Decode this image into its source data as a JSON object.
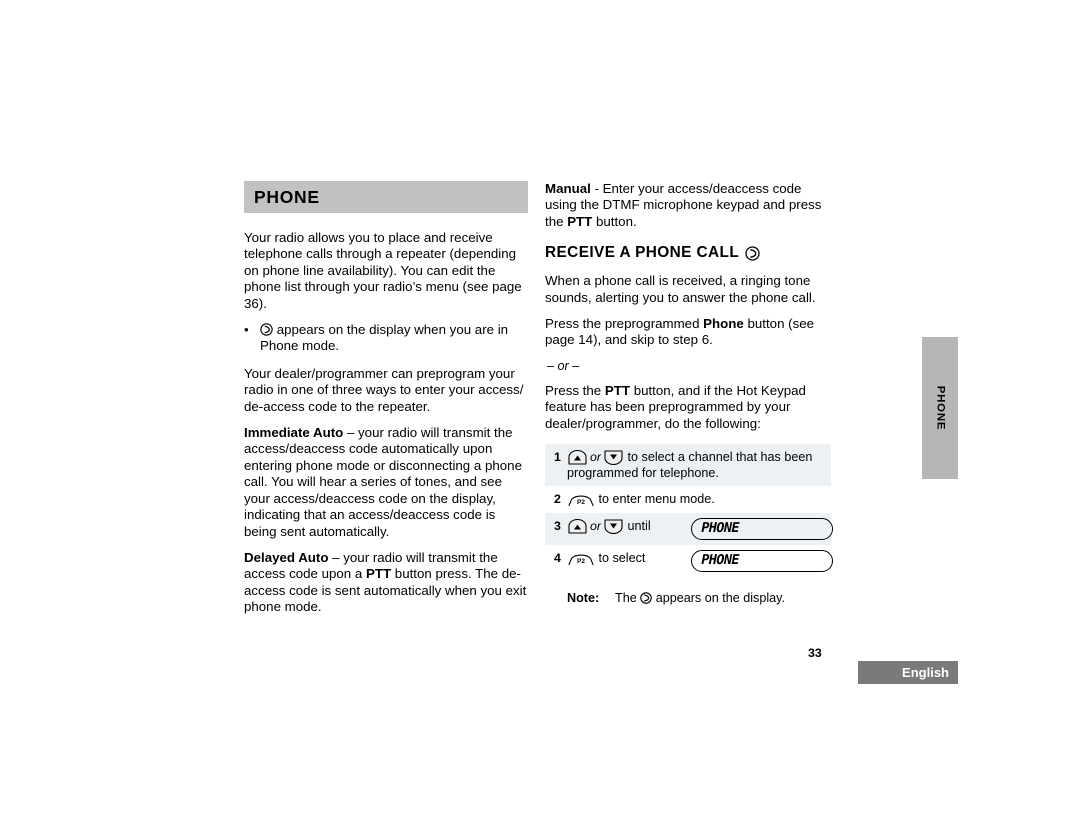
{
  "section": {
    "title": "PHONE"
  },
  "icons": {
    "phone_symbol": "phone-circle-icon",
    "up_key": "up-arrow-key-icon",
    "down_key": "down-arrow-key-icon",
    "p2_key": "p2-button-icon"
  },
  "left_column": {
    "paragraph_1": "Your radio allows you to place and receive telephone calls through a repeater (depending on phone line availability). You can edit the phone list through your radio’s menu (see page 36).",
    "bullet": {
      "marker": "•",
      "text_after_icon": " appears on the display when you are in Phone mode."
    },
    "paragraph_2": "Your dealer/programmer can preprogram your radio in one of three ways to enter your access/ de-access code to the repeater.",
    "immediate_auto": {
      "term": "Immediate Auto",
      "body": " – your radio will transmit the access/deaccess code automatically upon entering phone mode or disconnecting a phone call. You will hear a series of tones, and see your access/deaccess code on the display, indicating that an access/deaccess code is being sent automatically."
    },
    "delayed_auto": {
      "term": "Delayed Auto",
      "body_part1": " – your radio will transmit the access code upon a ",
      "ptt": "PTT",
      "body_part2": " button press. The de-access code is sent automatically when you exit phone mode."
    }
  },
  "right_column": {
    "manual": {
      "term": "Manual",
      "body_part1": " - Enter your access/deaccess code using the DTMF microphone keypad and press the ",
      "ptt": "PTT",
      "body_part2": " button."
    },
    "heading": "RECEIVE A PHONE CALL",
    "paragraph_1": "When a phone call is received, a ringing tone sounds, alerting you to answer the phone call.",
    "paragraph_2_part1": "Press the preprogrammed ",
    "paragraph_2_bold": "Phone",
    "paragraph_2_part2": " button (see page 14), and skip to step 6.",
    "or_line": "– or –",
    "paragraph_3_part1": "Press the ",
    "paragraph_3_bold": "PTT",
    "paragraph_3_part2": " button, and if the Hot Keypad feature has been preprogrammed by your dealer/programmer, do the following:",
    "steps": [
      {
        "num": "1",
        "keys": [
          "up",
          "or",
          "down"
        ],
        "text": " to select a channel that has been programmed for telephone.",
        "lcd": null,
        "shaded": true
      },
      {
        "num": "2",
        "keys": [
          "p2"
        ],
        "text": " to enter menu mode.",
        "lcd": null,
        "shaded": false
      },
      {
        "num": "3",
        "keys": [
          "up",
          "or",
          "down"
        ],
        "text": " until",
        "lcd": "PHONE",
        "shaded": true
      },
      {
        "num": "4",
        "keys": [
          "p2"
        ],
        "text": " to select",
        "lcd": "PHONE",
        "shaded": false
      }
    ],
    "note": {
      "label": "Note:",
      "text_before_icon": "The ",
      "text_after_icon": " appears on the display."
    },
    "key_labels": {
      "or": "or",
      "p2": "P2"
    }
  },
  "thumb_tab": {
    "label": "PHONE"
  },
  "footer": {
    "page_number": "33",
    "language": "English"
  },
  "colors": {
    "section_bar": "#c2c2c2",
    "row_shade": "#eef1f4",
    "thumb_tab": "#b6b6b6",
    "language_box": "#7a7a7a"
  }
}
